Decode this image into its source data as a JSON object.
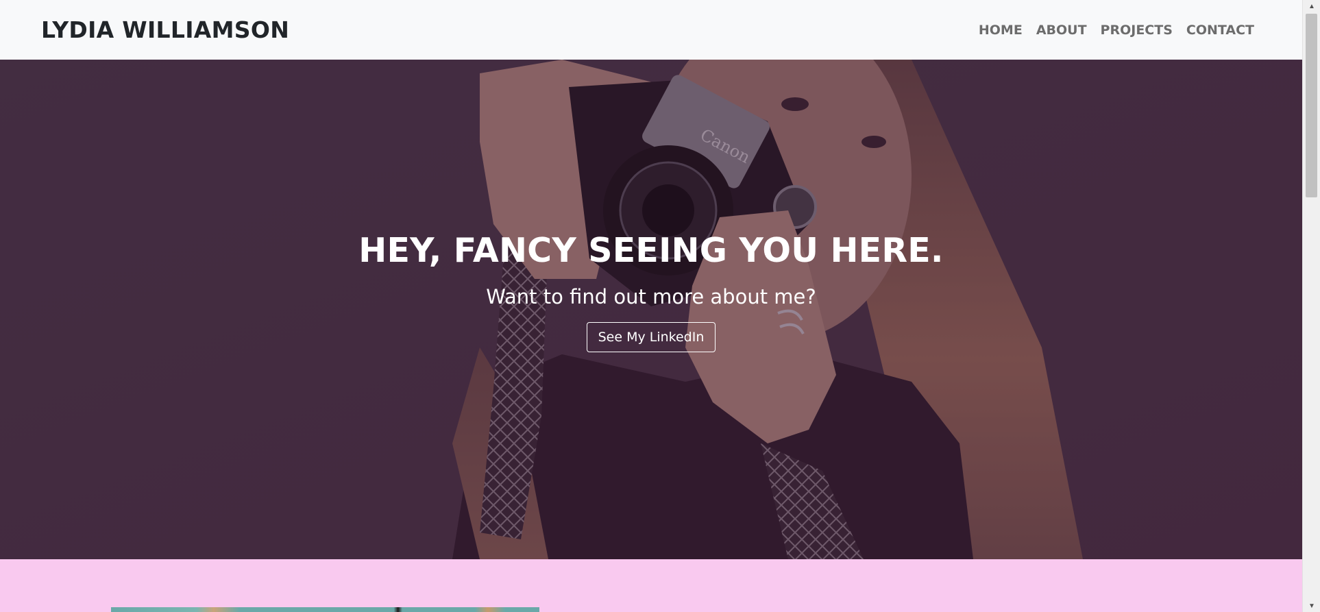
{
  "navbar": {
    "brand": "LYDIA WILLIAMSON",
    "links": [
      "HOME",
      "ABOUT",
      "PROJECTS",
      "CONTACT"
    ]
  },
  "hero": {
    "title": "HEY, FANCY SEEING YOU HERE.",
    "subtitle": "Want to find out more about me?",
    "button_label": "See My LinkedIn"
  },
  "icons": {
    "scroll_up": "caret-up-icon",
    "scroll_down": "caret-down-icon"
  },
  "colors": {
    "navbar_bg": "#f8f9fa",
    "hero_overlay": "#3a2438",
    "pink_section": "#f9c9ef"
  }
}
